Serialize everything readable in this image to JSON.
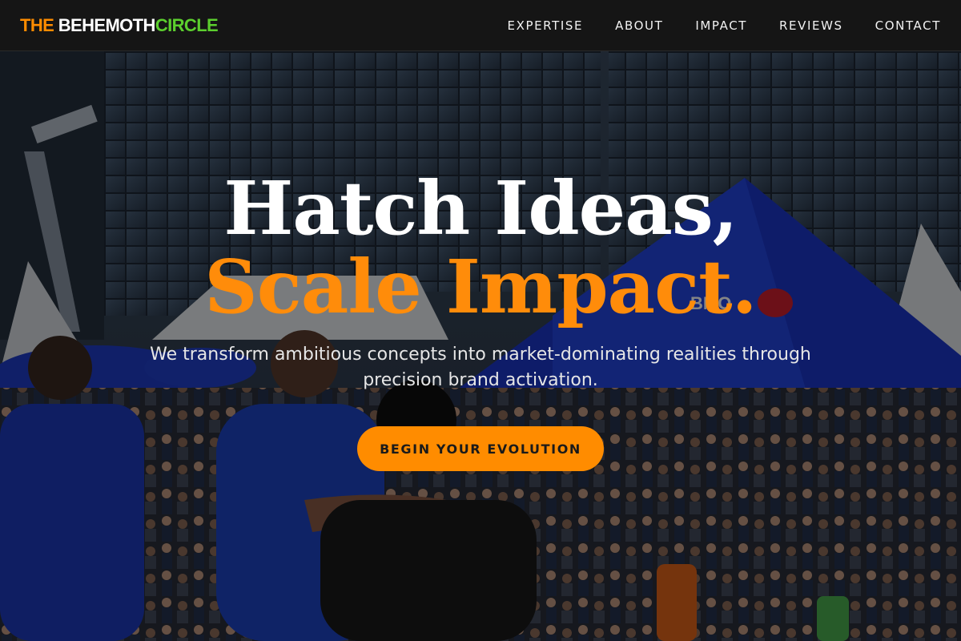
{
  "brand": {
    "part1": "THE",
    "part2": "BEHEMOTH",
    "part3": "CIRCLE"
  },
  "nav": {
    "items": [
      {
        "label": "EXPERTISE"
      },
      {
        "label": "ABOUT"
      },
      {
        "label": "IMPACT"
      },
      {
        "label": "REVIEWS"
      },
      {
        "label": "CONTACT"
      }
    ]
  },
  "hero": {
    "headline_line1": "Hatch Ideas,",
    "headline_line2": "Scale Impact.",
    "subheadline": "We transform ambitious concepts into market-dominating realities through precision brand activation.",
    "cta_label": "BEGIN YOUR EVOLUTION",
    "tent_signage": "BMO"
  },
  "colors": {
    "accent_orange": "#ff8c00",
    "accent_green": "#5ccf2e",
    "header_bg": "#151515"
  }
}
